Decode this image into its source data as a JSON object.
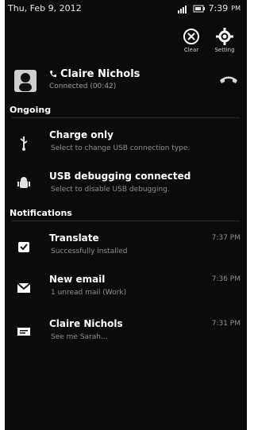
{
  "statusbar": {
    "date": "Thu, Feb 9, 2012",
    "time": "7:39",
    "ampm": "PM"
  },
  "quick_actions": {
    "clear_label": "Clear",
    "setting_label": "Setting"
  },
  "call": {
    "name": "Claire Nichols",
    "status": "Connected (00:42)"
  },
  "sections": {
    "ongoing": "Ongoing",
    "notifications": "Notifications"
  },
  "ongoing": [
    {
      "title": "Charge only",
      "desc": "Select to change USB connection type.",
      "icon": "usb-icon"
    },
    {
      "title": "USB debugging connected",
      "desc": "Select to disable USB debugging.",
      "icon": "android-icon"
    }
  ],
  "notifications": [
    {
      "title": "Translate",
      "desc": "Successfully installed",
      "time": "7:37 PM",
      "icon": "shopping-bag-icon"
    },
    {
      "title": "New email",
      "desc": "1 unread mail (Work)",
      "time": "7:36 PM",
      "icon": "mail-icon"
    },
    {
      "title": "Claire Nichols",
      "desc": "See me Sarah...",
      "time": "7:31 PM",
      "icon": "message-icon"
    }
  ],
  "colors": {
    "background": "#0b0b0b",
    "text": "#ffffff",
    "secondary_text": "#8e8e8e",
    "end_call": "#d9d9d9"
  }
}
